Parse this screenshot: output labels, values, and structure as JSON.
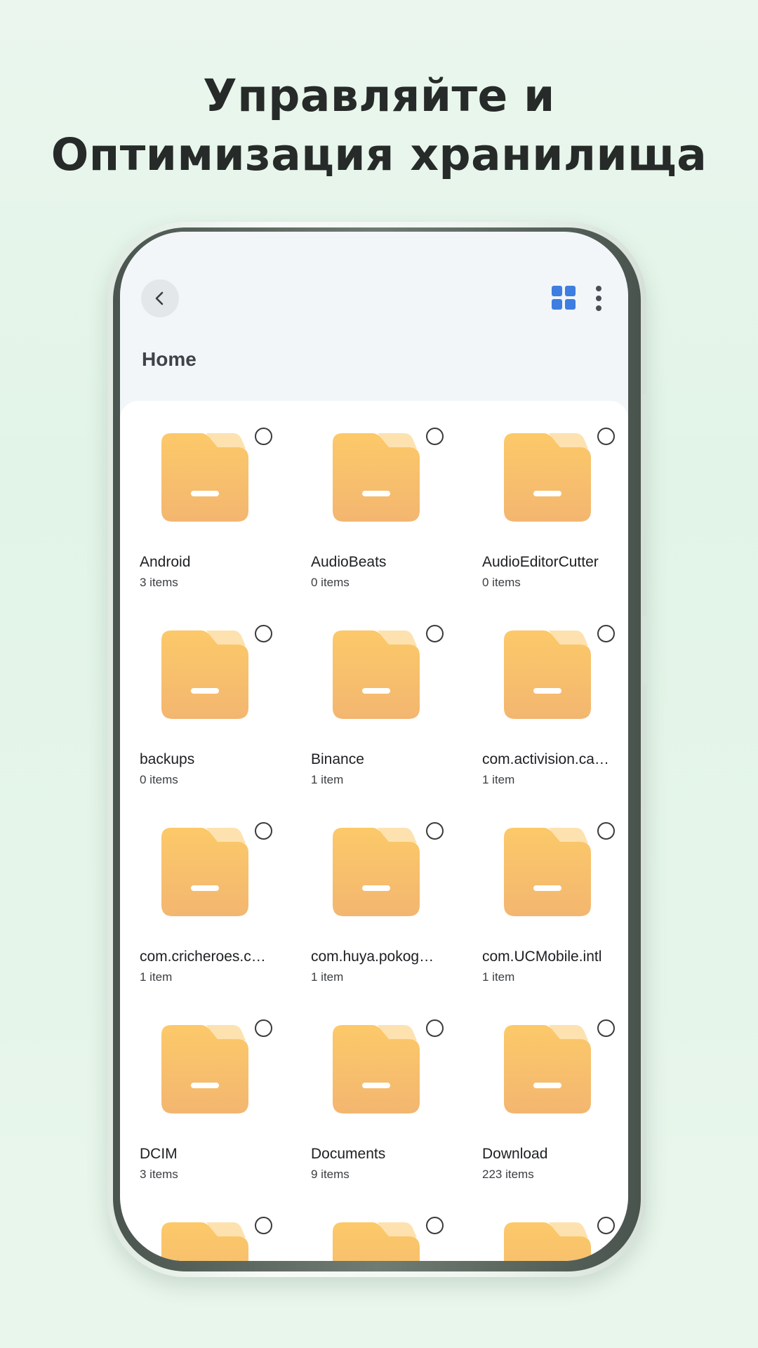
{
  "headline": {
    "line1": "Управляйте и",
    "line2": "Оптимизация хранилища"
  },
  "header": {
    "back_icon": "chevron-left-icon",
    "view_toggle_icon": "grid-view-icon",
    "more_icon": "more-vertical-icon",
    "title": "Home"
  },
  "colors": {
    "folder_top": "#fcc969",
    "folder_bottom": "#f3b670",
    "folder_tab": "#fde2b0",
    "accent": "#3d7ee0"
  },
  "folders": [
    {
      "name": "Android",
      "count": "3 items"
    },
    {
      "name": "AudioBeats",
      "count": "0 items"
    },
    {
      "name": "AudioEditorCutter",
      "count": "0 items"
    },
    {
      "name": "backups",
      "count": "0 items"
    },
    {
      "name": "Binance",
      "count": "1 item"
    },
    {
      "name": "com.activision.ca…",
      "count": "1 item"
    },
    {
      "name": "com.cricheroes.c…",
      "count": "1 item"
    },
    {
      "name": "com.huya.pokog…",
      "count": "1 item"
    },
    {
      "name": "com.UCMobile.intl",
      "count": "1 item"
    },
    {
      "name": "DCIM",
      "count": "3 items"
    },
    {
      "name": "Documents",
      "count": "9 items"
    },
    {
      "name": "Download",
      "count": "223 items"
    },
    {
      "name": "",
      "count": ""
    },
    {
      "name": "",
      "count": ""
    },
    {
      "name": "",
      "count": ""
    }
  ]
}
